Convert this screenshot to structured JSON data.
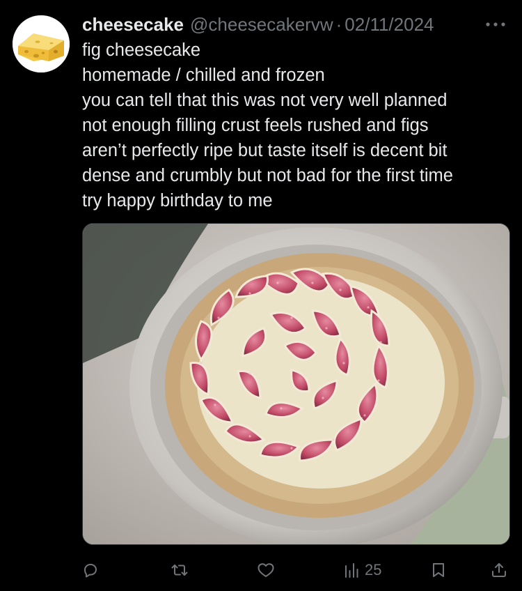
{
  "tweet": {
    "display_name": "cheesecake",
    "handle": "@cheesecakervw",
    "separator": "·",
    "date": "02/11/2024",
    "text_lines": [
      "fig cheesecake",
      "homemade / chilled and frozen",
      "you can tell that this was not very well planned",
      "not enough filling crust feels rushed and figs",
      "aren’t perfectly ripe but taste itself is decent bit",
      "dense and crumbly but not bad for the first time",
      "try happy birthday to me"
    ]
  },
  "actions": {
    "reply_icon": "reply-icon",
    "retweet_icon": "retweet-icon",
    "like_icon": "heart-icon",
    "views_icon": "views-icon",
    "views_count": "25",
    "bookmark_icon": "bookmark-icon",
    "share_icon": "share-icon"
  },
  "colors": {
    "background": "#000000",
    "text": "#e7e9ea",
    "secondary": "#71767b"
  }
}
